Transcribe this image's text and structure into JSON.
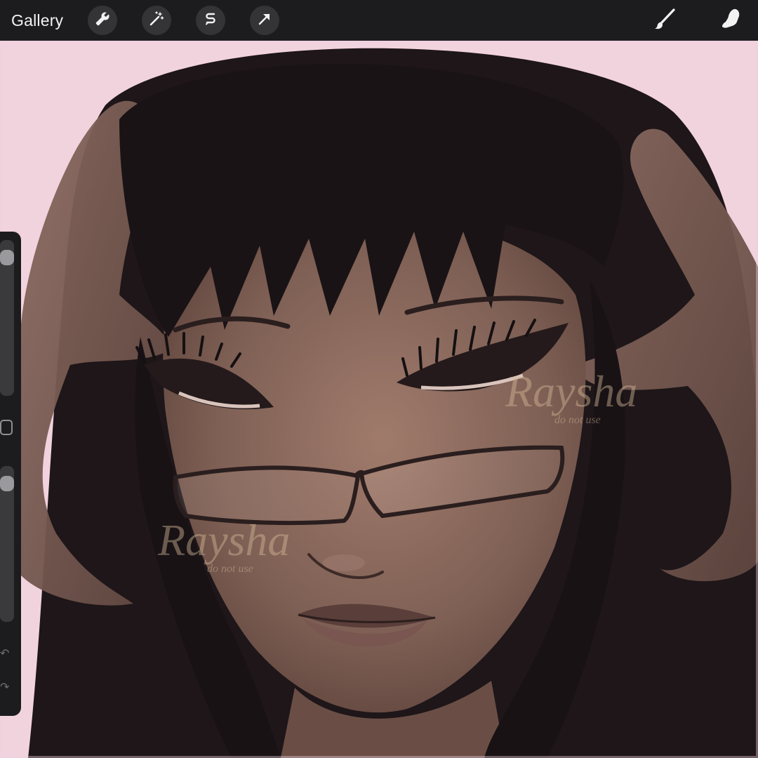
{
  "toolbar": {
    "gallery_label": "Gallery",
    "left_tools": [
      {
        "name": "actions",
        "icon": "wrench-icon"
      },
      {
        "name": "adjustments",
        "icon": "magic-wand-icon"
      },
      {
        "name": "selection",
        "icon": "selection-s-icon"
      },
      {
        "name": "transform",
        "icon": "arrow-cursor-icon"
      }
    ],
    "right_tools": [
      {
        "name": "brush",
        "icon": "brush-icon"
      },
      {
        "name": "smudge",
        "icon": "smudge-finger-icon"
      }
    ]
  },
  "sidebar": {
    "brush_size_level": 0.05,
    "opacity_level": 0.05,
    "buttons": [
      {
        "name": "modify",
        "icon": "square-modify-icon"
      },
      {
        "name": "undo",
        "icon": "undo-arrow-icon"
      },
      {
        "name": "redo",
        "icon": "redo-arrow-icon"
      }
    ]
  },
  "canvas": {
    "subject": "artwork",
    "watermark_signature": "Raysha",
    "watermark_subtitle": "do not use"
  },
  "colors": {
    "toolbar_bg": "#1c1c1e",
    "background_pink": "#f1d3de",
    "hair": "#1e1619",
    "skin": "#8a6a60"
  }
}
